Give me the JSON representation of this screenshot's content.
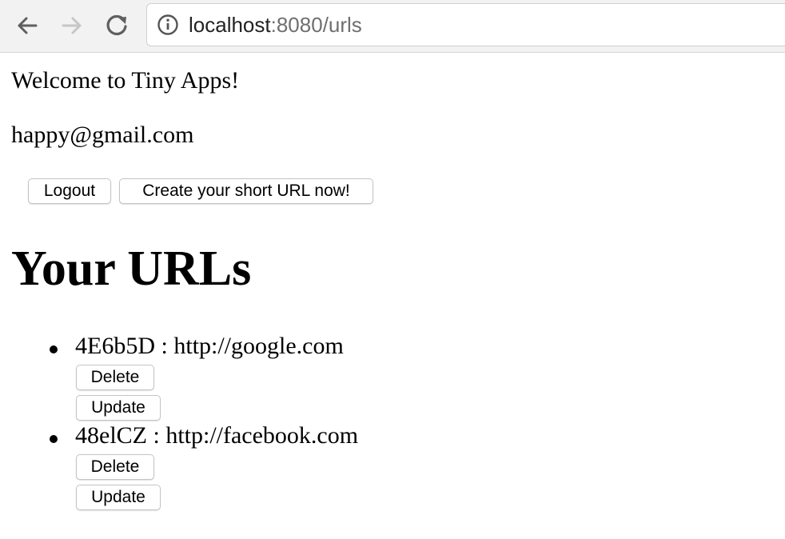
{
  "browser": {
    "url_host": "localhost",
    "url_rest": ":8080/urls",
    "icons": {
      "back": "back-arrow-icon",
      "forward": "forward-arrow-icon",
      "reload": "reload-icon",
      "info": "info-icon"
    }
  },
  "page": {
    "welcome": "Welcome to Tiny Apps!",
    "email": "happy@gmail.com",
    "logout_label": "Logout",
    "create_label": "Create your short URL now!",
    "heading": "Your URLs",
    "urls": [
      {
        "text": "4E6b5D : http://google.com",
        "delete_label": "Delete",
        "update_label": "Update"
      },
      {
        "text": "48elCZ : http://facebook.com",
        "delete_label": "Delete",
        "update_label": "Update"
      }
    ]
  }
}
